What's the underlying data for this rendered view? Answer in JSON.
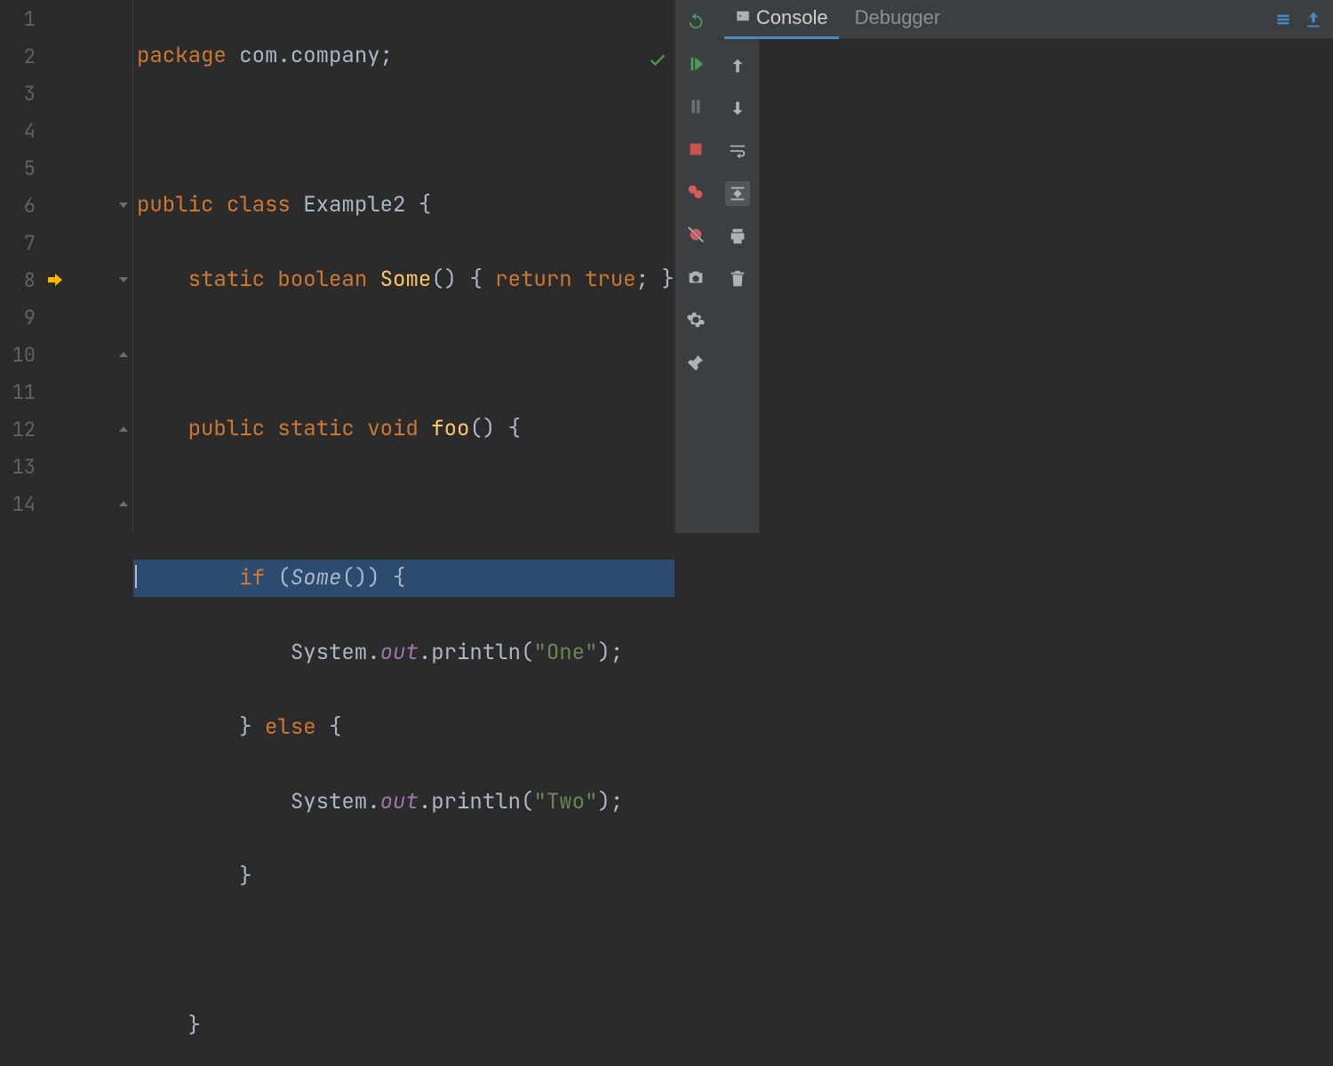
{
  "code": {
    "lines": [
      {
        "n": 1,
        "arrow": false,
        "fold": false
      },
      {
        "n": 2,
        "arrow": false,
        "fold": false
      },
      {
        "n": 3,
        "arrow": false,
        "fold": false
      },
      {
        "n": 4,
        "arrow": false,
        "fold": false
      },
      {
        "n": 5,
        "arrow": false,
        "fold": false
      },
      {
        "n": 6,
        "arrow": false,
        "fold": true
      },
      {
        "n": 7,
        "arrow": false,
        "fold": false
      },
      {
        "n": 8,
        "arrow": true,
        "fold": true
      },
      {
        "n": 9,
        "arrow": false,
        "fold": false
      },
      {
        "n": 10,
        "arrow": false,
        "fold": true
      },
      {
        "n": 11,
        "arrow": false,
        "fold": false
      },
      {
        "n": 12,
        "arrow": false,
        "fold": true
      },
      {
        "n": 13,
        "arrow": false,
        "fold": false
      },
      {
        "n": 14,
        "arrow": false,
        "fold": true
      }
    ],
    "highlighted_line": 8,
    "tokens": {
      "package": "package",
      "pkgname": "com.company",
      "public": "public",
      "class": "class",
      "clsname": "Example2",
      "static": "static",
      "boolean": "boolean",
      "some": "Some",
      "return": "return",
      "true": "true",
      "void": "void",
      "foo": "foo",
      "if": "if",
      "system": "System",
      "out": "out",
      "println": "println",
      "one": "\"One\"",
      "else": "else",
      "two": "\"Two\""
    }
  },
  "tabs": {
    "console": "Console",
    "debugger": "Debugger"
  },
  "status": {
    "analysis": "no-problems"
  }
}
